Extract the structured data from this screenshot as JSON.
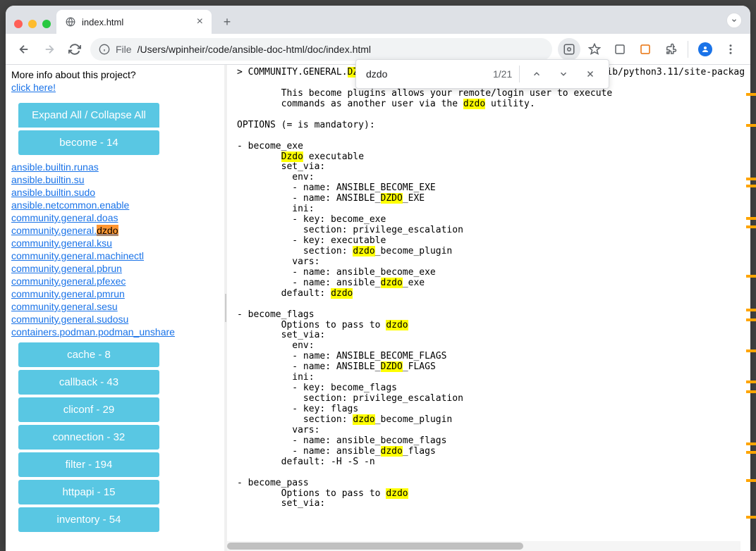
{
  "tab": {
    "title": "index.html"
  },
  "url": {
    "scheme_label": "File",
    "path": "/Users/wpinheir/code/ansible-doc-html/doc/index.html"
  },
  "find": {
    "query": "dzdo",
    "count": "1/21"
  },
  "sidebar": {
    "info": "More info about this project?",
    "click_here": "click here!",
    "expand_collapse": "Expand All / Collapse All",
    "become_header": "become - 14",
    "items": [
      "ansible.builtin.runas",
      "ansible.builtin.su",
      "ansible.builtin.sudo",
      "ansible.netcommon.enable",
      "community.general.doas",
      "community.general.dzdo",
      "community.general.ksu",
      "community.general.machinectl",
      "community.general.pbrun",
      "community.general.pfexec",
      "community.general.pmrun",
      "community.general.sesu",
      "community.general.sudosu",
      "containers.podman.podman_unshare"
    ],
    "categories": [
      "cache - 8",
      "callback - 43",
      "cliconf - 29",
      "connection - 32",
      "filter - 194",
      "httpapi - 15",
      "inventory - 54"
    ]
  },
  "main": {
    "header_prefix": "> COMMUNITY.GENERAL.",
    "header_hl": "DZDO",
    "header_suffix": "    (/Users/wpinheir/.venv/lab_automation/lib/python3.11/site-packag",
    "desc_line1": "        This become plugins allows your remote/login user to execute",
    "desc_line2a": "        commands as another user via the ",
    "desc_line2b": " utility.",
    "options": "OPTIONS (= is mandatory):",
    "be_exe": "- become_exe",
    "be_exe_l1a": "        ",
    "be_exe_l1_hl": "Dzdo",
    "be_exe_l1b": " executable",
    "set_via": "        set_via:",
    "env": "          env:",
    "env_becexe": "          - name: ANSIBLE_BECOME_EXE",
    "env_dzdo_pre": "          - name: ANSIBLE_",
    "env_dzdo_hl": "DZDO",
    "env_dzdo_suf": "_EXE",
    "ini": "          ini:",
    "ini_key_be": "          - key: become_exe",
    "ini_sec_priv": "            section: privilege_escalation",
    "ini_key_exe": "          - key: executable",
    "ini_sec_dz_pre": "            section: ",
    "ini_sec_dz_suf": "_become_plugin",
    "vars": "          vars:",
    "var_be_exe": "          - name: ansible_become_exe",
    "var_dz_pre": "          - name: ansible_",
    "var_dz_suf": "_exe",
    "default_pre": "        default: ",
    "be_flags": "- become_flags",
    "bf_opt_pre": "        Options to pass to ",
    "env_becflags": "          - name: ANSIBLE_BECOME_FLAGS",
    "env_dzflags_suf": "_FLAGS",
    "ini_key_bf": "          - key: become_flags",
    "ini_key_flags": "          - key: flags",
    "var_bf": "          - name: ansible_become_flags",
    "var_dzf_suf": "_flags",
    "bf_default": "        default: -H -S -n",
    "be_pass": "- become_pass",
    "dzdo": "dzdo"
  }
}
